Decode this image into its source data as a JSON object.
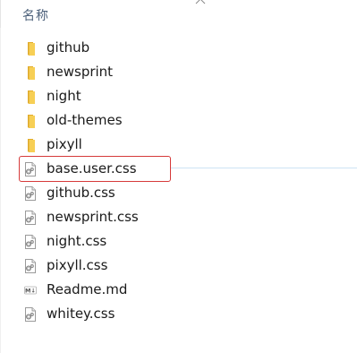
{
  "header": {
    "column_name": "名称",
    "sort_indicator": "caret-up-icon"
  },
  "files": [
    {
      "name": "github",
      "type": "folder",
      "icon": "folder-icon"
    },
    {
      "name": "newsprint",
      "type": "folder",
      "icon": "folder-icon"
    },
    {
      "name": "night",
      "type": "folder",
      "icon": "folder-icon"
    },
    {
      "name": "old-themes",
      "type": "folder",
      "icon": "folder-icon"
    },
    {
      "name": "pixyll",
      "type": "folder",
      "icon": "folder-icon"
    },
    {
      "name": "base.user.css",
      "type": "css",
      "icon": "css-file-icon",
      "highlighted": true
    },
    {
      "name": "github.css",
      "type": "css",
      "icon": "css-file-icon"
    },
    {
      "name": "newsprint.css",
      "type": "css",
      "icon": "css-file-icon"
    },
    {
      "name": "night.css",
      "type": "css",
      "icon": "css-file-icon"
    },
    {
      "name": "pixyll.css",
      "type": "css",
      "icon": "css-file-icon"
    },
    {
      "name": "Readme.md",
      "type": "md",
      "icon": "markdown-file-icon"
    },
    {
      "name": "whitey.css",
      "type": "css",
      "icon": "css-file-icon"
    }
  ],
  "colors": {
    "folder": "#f5c543",
    "highlight_border": "#d63a3a",
    "header_text": "#4c607a"
  }
}
